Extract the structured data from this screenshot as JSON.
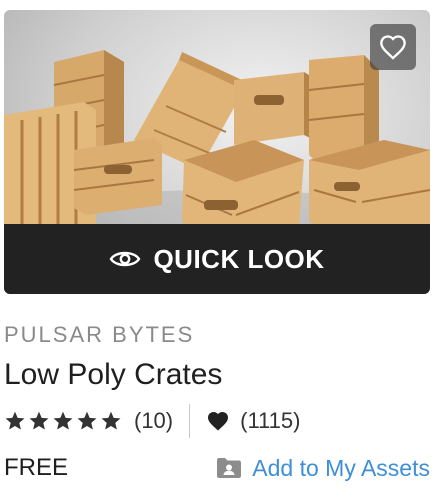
{
  "product": {
    "publisher": "PULSAR BYTES",
    "title": "Low Poly Crates",
    "rating_stars": 5,
    "rating_count": "(10)",
    "favorites_count": "(1115)",
    "price": "FREE"
  },
  "actions": {
    "quick_look_label": "QUICK LOOK",
    "add_to_assets_label": "Add to My Assets"
  },
  "colors": {
    "quick_look_bg": "#222222",
    "link": "#3f8fd8",
    "publisher_text": "#8a8a8a",
    "star": "#333333"
  },
  "icons": [
    "heart-outline-icon",
    "eye-icon",
    "star-icon",
    "heart-filled-icon",
    "folder-user-icon"
  ]
}
